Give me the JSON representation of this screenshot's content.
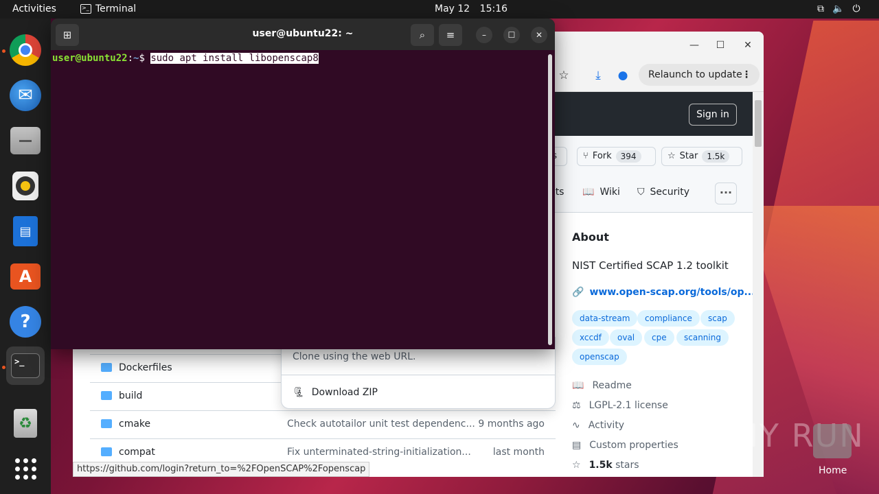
{
  "topbar": {
    "activities": "Activities",
    "app_name": "Terminal",
    "date": "May 12",
    "time": "15:16"
  },
  "dock": {
    "items": [
      "chrome-icon",
      "thunderbird-icon",
      "files-icon",
      "rhythmbox-icon",
      "libreoffice-writer-icon",
      "app-center-icon",
      "help-icon",
      "terminal-icon",
      "trash-icon",
      "show-apps-icon"
    ]
  },
  "terminal": {
    "title": "user@ubuntu22: ~",
    "prompt_user": "user@ubuntu22",
    "prompt_sep": ":",
    "prompt_path": "~",
    "prompt_symbol": "$",
    "command": "sudo apt install libopenscap8 "
  },
  "browser": {
    "relaunch_label": "Relaunch to update",
    "signin_label": "Sign in",
    "partial_actions": "ns",
    "fork_label": "Fork",
    "fork_count": "394",
    "star_label": "Star",
    "star_count": "1.5k",
    "tabs": {
      "partial": "cts",
      "wiki": "Wiki",
      "security": "Security"
    },
    "about": {
      "heading": "About",
      "description": "NIST Certified SCAP 1.2 toolkit",
      "link": "www.open-scap.org/tools/op...",
      "topics": [
        "data-stream",
        "compliance",
        "scap",
        "xccdf",
        "oval",
        "cpe",
        "scanning",
        "openscap"
      ],
      "readme": "Readme",
      "license": "LGPL-2.1 license",
      "activity": "Activity",
      "custom_properties": "Custom properties",
      "stars_count": "1.5k",
      "stars_label": "stars"
    },
    "files": [
      {
        "name": "Dockerfiles",
        "message": "",
        "date": ""
      },
      {
        "name": "build",
        "message": "",
        "date": ""
      },
      {
        "name": "cmake",
        "message": "Check autotailor unit test dependenc...",
        "date": "9 months ago"
      },
      {
        "name": "compat",
        "message": "Fix unterminated-string-initialization...",
        "date": "last month"
      }
    ],
    "clone": {
      "text": "Clone using the web URL.",
      "download_zip": "Download ZIP"
    },
    "status_url": "https://github.com/login?return_to=%2FOpenSCAP%2Fopenscap"
  },
  "desktop": {
    "watermark": "ANY RUN",
    "home_label": "Home"
  },
  "colors": {
    "terminal_bg": "#300a24",
    "ubuntu_orange": "#e95420",
    "github_header": "#24292f",
    "link_blue": "#0969da"
  }
}
